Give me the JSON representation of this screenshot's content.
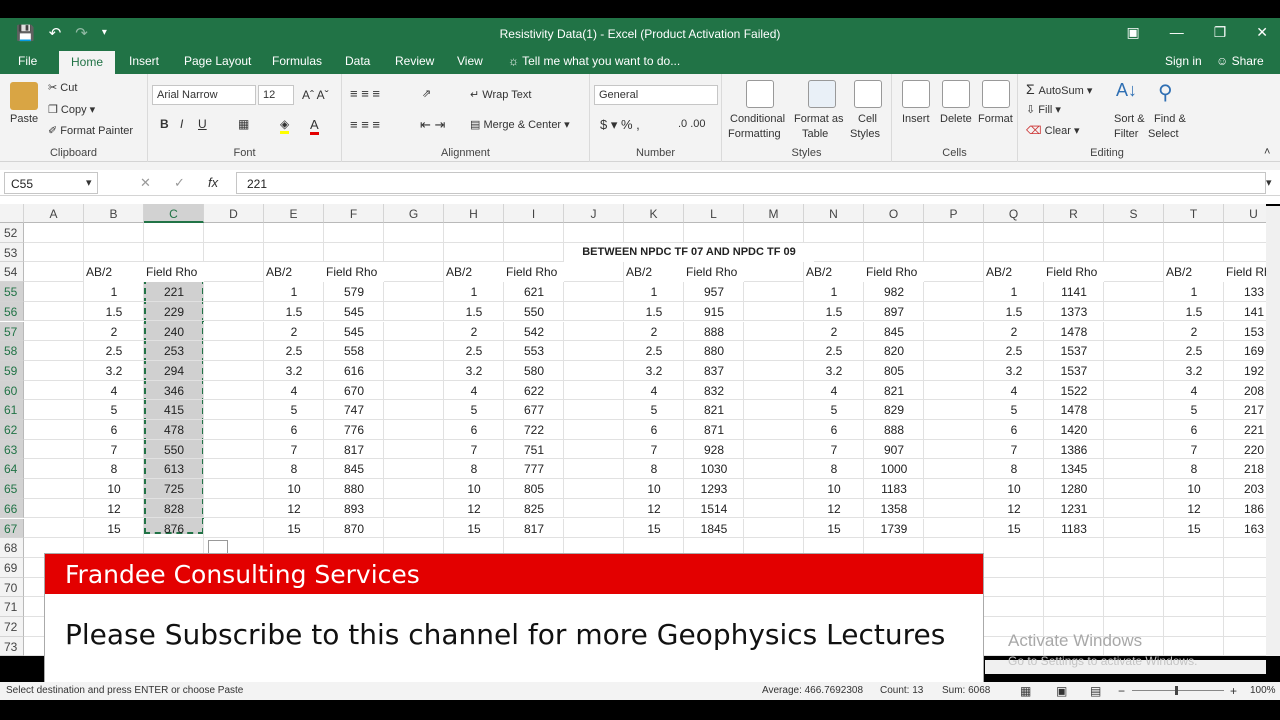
{
  "window": {
    "title": "Resistivity Data(1) - Excel (Product Activation Failed)"
  },
  "tabs": [
    "File",
    "Home",
    "Insert",
    "Page Layout",
    "Formulas",
    "Data",
    "Review",
    "View"
  ],
  "tell_me": "Tell me what you want to do...",
  "account": {
    "sign_in": "Sign in",
    "share": "Share"
  },
  "ribbon": {
    "clipboard": {
      "paste": "Paste",
      "cut": "Cut",
      "copy": "Copy",
      "format_painter": "Format Painter",
      "label": "Clipboard"
    },
    "font": {
      "name": "Arial Narrow",
      "size": "12",
      "label": "Font"
    },
    "alignment": {
      "wrap_text": "Wrap Text",
      "merge_center": "Merge & Center",
      "label": "Alignment"
    },
    "number": {
      "format": "General",
      "label": "Number"
    },
    "styles": {
      "conditional": "Conditional",
      "formatting": "Formatting",
      "format_as": "Format as",
      "table": "Table",
      "cell": "Cell",
      "styles": "Styles",
      "label": "Styles"
    },
    "cells": {
      "insert": "Insert",
      "delete": "Delete",
      "format": "Format",
      "label": "Cells"
    },
    "editing": {
      "autosum": "AutoSum",
      "fill": "Fill",
      "clear": "Clear",
      "sort": "Sort &",
      "filter": "Filter",
      "find": "Find &",
      "select": "Select",
      "label": "Editing"
    }
  },
  "formula_bar": {
    "name_box": "C55",
    "fx": "fx",
    "value": "221"
  },
  "columns": [
    "A",
    "B",
    "C",
    "D",
    "E",
    "F",
    "G",
    "H",
    "I",
    "J",
    "K",
    "L",
    "M",
    "N",
    "O",
    "P",
    "Q",
    "R",
    "S",
    "T",
    "U"
  ],
  "rows": [
    "52",
    "53",
    "54",
    "55",
    "56",
    "57",
    "58",
    "59",
    "60",
    "61",
    "62",
    "63",
    "64",
    "65",
    "66",
    "67",
    "68",
    "69",
    "70",
    "71",
    "72",
    "73"
  ],
  "sheet": {
    "section_title": "BETWEEN NPDC TF 07 AND NPDC TF 09",
    "ab_header": "AB/2",
    "rho_header": "Field Rho",
    "ab": [
      "1",
      "1.5",
      "2",
      "2.5",
      "3.2",
      "4",
      "5",
      "6",
      "7",
      "8",
      "10",
      "12",
      "15"
    ],
    "series": [
      [
        "221",
        "229",
        "240",
        "253",
        "294",
        "346",
        "415",
        "478",
        "550",
        "613",
        "725",
        "828",
        "876"
      ],
      [
        "579",
        "545",
        "545",
        "558",
        "616",
        "670",
        "747",
        "776",
        "817",
        "845",
        "880",
        "893",
        "870"
      ],
      [
        "621",
        "550",
        "542",
        "553",
        "580",
        "622",
        "677",
        "722",
        "751",
        "777",
        "805",
        "825",
        "817"
      ],
      [
        "957",
        "915",
        "888",
        "880",
        "837",
        "832",
        "821",
        "871",
        "928",
        "1030",
        "1293",
        "1514",
        "1845"
      ],
      [
        "982",
        "897",
        "845",
        "820",
        "805",
        "821",
        "829",
        "888",
        "907",
        "1000",
        "1183",
        "1358",
        "1739"
      ],
      [
        "1141",
        "1373",
        "1478",
        "1537",
        "1537",
        "1522",
        "1478",
        "1420",
        "1386",
        "1345",
        "1280",
        "1231",
        "1183"
      ],
      [
        "133",
        "141",
        "153",
        "169",
        "192",
        "208",
        "217",
        "221",
        "220",
        "218",
        "203",
        "186",
        "163"
      ]
    ]
  },
  "banner": {
    "company": "Frandee Consulting Services",
    "message": "Please Subscribe to this channel for more Geophysics Lectures"
  },
  "watermark": {
    "line1": "Activate Windows",
    "line2": "Go to Settings to activate Windows."
  },
  "status": {
    "mode": "Select destination and press ENTER or choose Paste",
    "average": "Average: 466.7692308",
    "count": "Count: 13",
    "sum": "Sum: 6068",
    "zoom": "100%"
  },
  "colors": {
    "excel_green": "#217346",
    "banner_red": "#e30000"
  }
}
